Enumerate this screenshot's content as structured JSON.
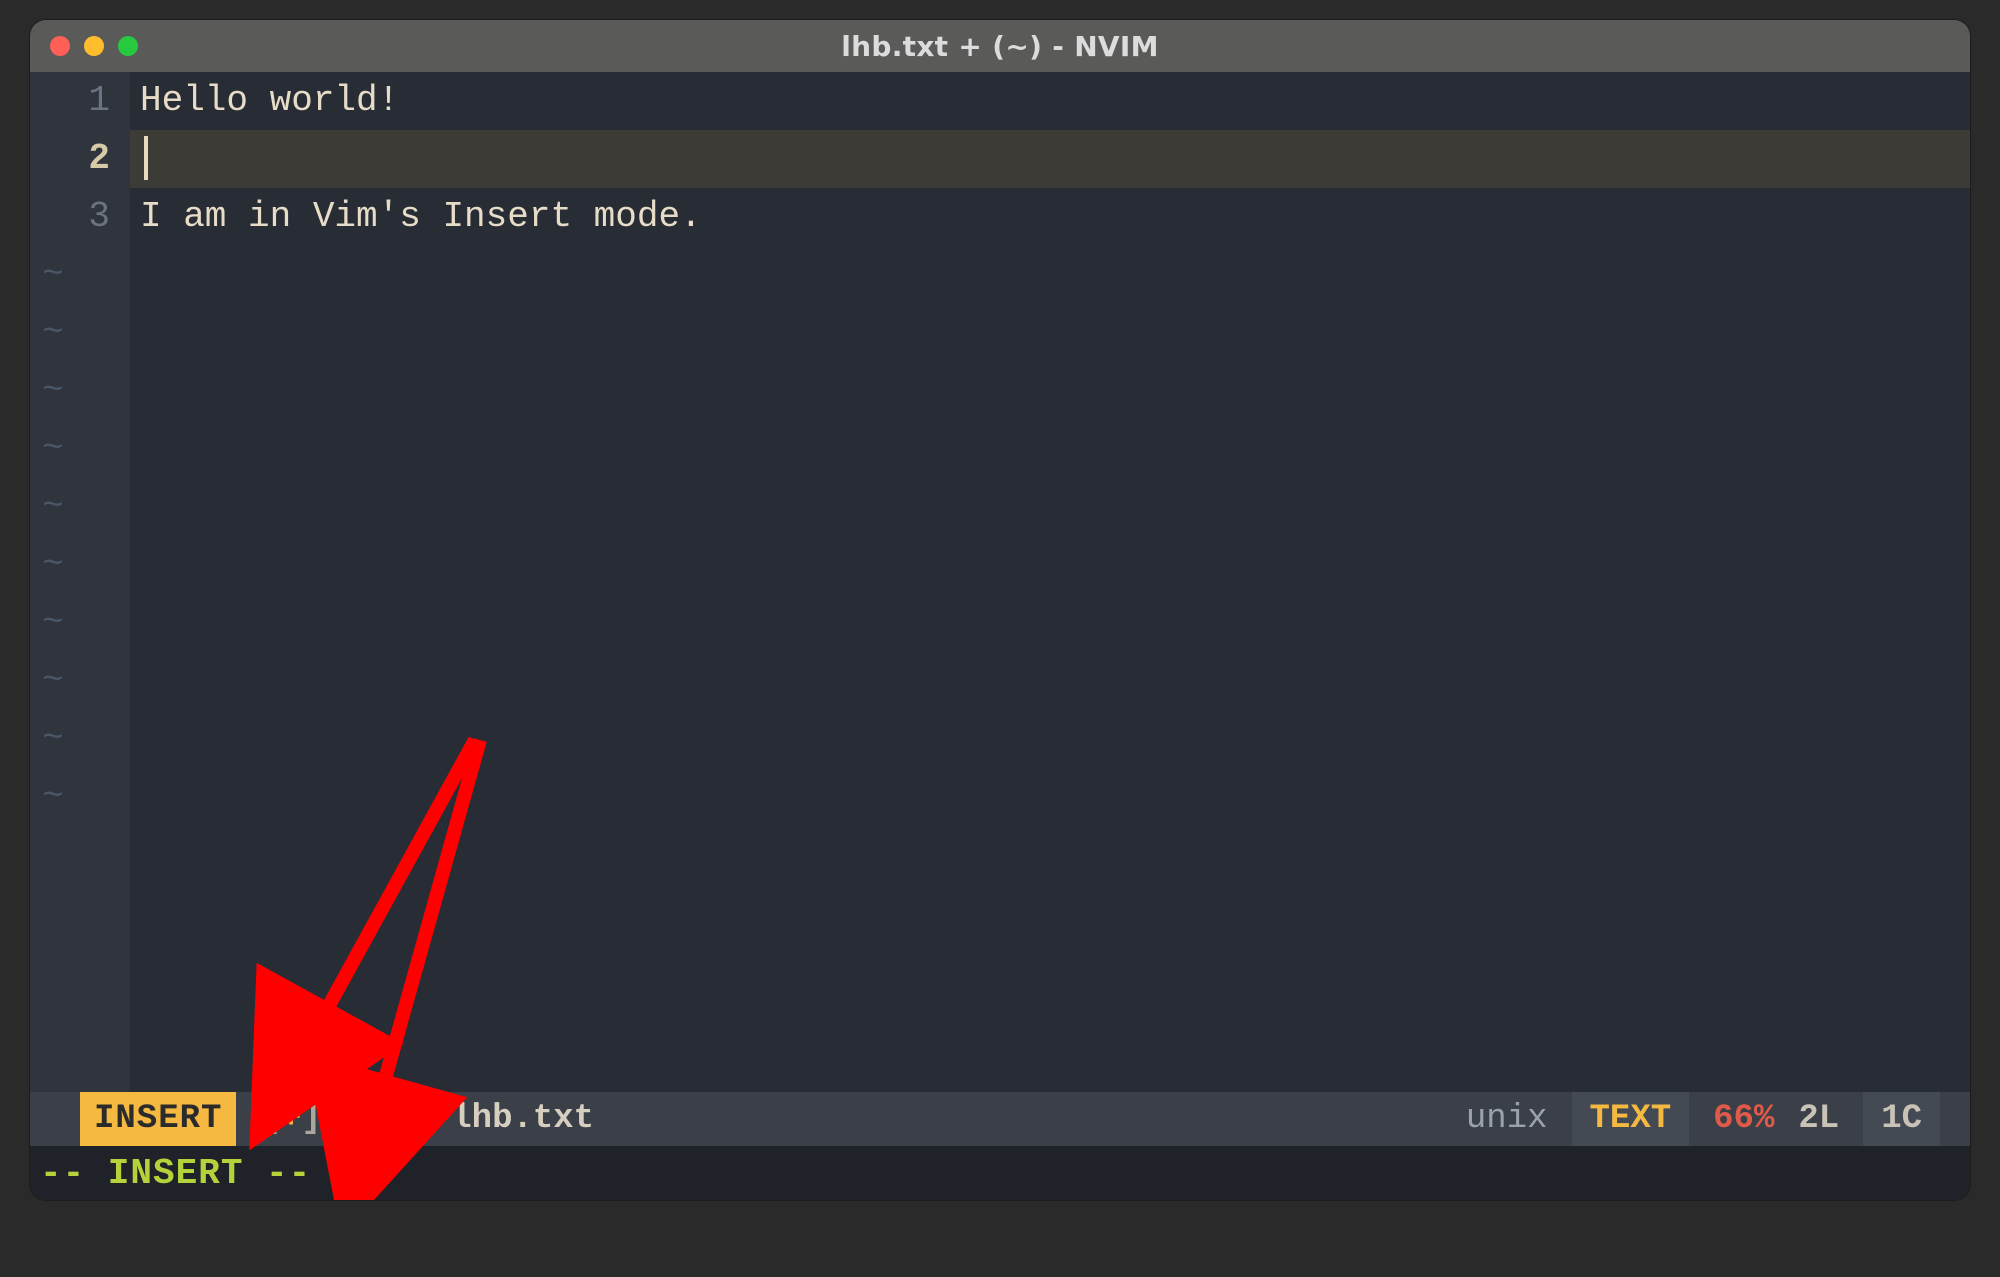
{
  "window": {
    "title": "lhb.txt + (~) - NVIM"
  },
  "editor": {
    "lines": [
      {
        "num": "1",
        "text": "Hello world!",
        "current": false
      },
      {
        "num": "2",
        "text": "",
        "current": true
      },
      {
        "num": "3",
        "text": "I am in Vim's Insert mode.",
        "current": false
      }
    ],
    "tilde_count": 10,
    "tilde_glyph": "~"
  },
  "statusbar": {
    "mode": "INSERT",
    "modified_open": "[",
    "modified_plus": "+",
    "modified_close": "]",
    "rw": "[RW]",
    "filename": "lhb.txt",
    "fileformat": "unix",
    "filetype": "TEXT",
    "percent": "66%",
    "line_pos": "2L",
    "col_pos": "1C"
  },
  "cmdline": {
    "text": "-- INSERT --"
  },
  "annotation": {
    "color": "#ff0000"
  }
}
